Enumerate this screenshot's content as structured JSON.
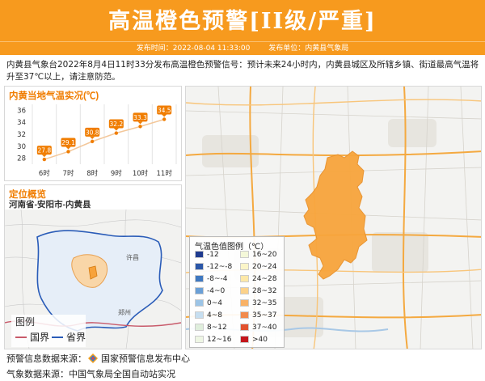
{
  "header": {
    "title": "高温橙色预警[II级/严重]",
    "publish_time_label": "发布时间：2022-08-04 11:33:00",
    "publisher_label": "发布单位：内黄县气象局"
  },
  "description": "内黄县气象台2022年8月4日11时33分发布高温橙色预警信号：预计未来24小时内，内黄县城区及所辖乡镇、街道最高气温将升至37℃以上，请注意防范。",
  "temp_panel": {
    "title": "内黄当地气温实况(℃)"
  },
  "location_panel": {
    "title": "定位概览",
    "path": "河南省-安阳市-内黄县",
    "legend_title": "图例",
    "legend_items": [
      {
        "label": "国界",
        "color": "#c85a6a"
      },
      {
        "label": "省界",
        "color": "#2a5cb8"
      }
    ],
    "place_labels": [
      "许昌",
      "郑州"
    ]
  },
  "map_panel": {
    "legend_title": "气温色值图例（℃）",
    "left_entries": [
      {
        "label": "-12",
        "color": "#1f3b8f"
      },
      {
        "label": "-12~-8",
        "color": "#2b57a8"
      },
      {
        "label": "-8~-4",
        "color": "#3f78c0"
      },
      {
        "label": "-4~0",
        "color": "#6a9fd6"
      },
      {
        "label": "0~4",
        "color": "#9cc4e6"
      },
      {
        "label": "4~8",
        "color": "#c6def0"
      },
      {
        "label": "8~12",
        "color": "#dfeedc"
      },
      {
        "label": "12~16",
        "color": "#eef6e4"
      }
    ],
    "right_entries": [
      {
        "label": "16~20",
        "color": "#f4f8d9"
      },
      {
        "label": "20~24",
        "color": "#fbf5c8"
      },
      {
        "label": "24~28",
        "color": "#fde8a8"
      },
      {
        "label": "28~32",
        "color": "#fcd28a"
      },
      {
        "label": "32~35",
        "color": "#f9b267"
      },
      {
        "label": "35~37",
        "color": "#f28a4c"
      },
      {
        "label": "37~40",
        "color": "#e2522e"
      },
      {
        "label": ">40",
        "color": "#c4161c"
      }
    ]
  },
  "sources": {
    "warning_source": "预警信息数据来源：",
    "warning_source_name": "国家预警信息发布中心",
    "weather_source": "气象数据来源：中国气象局全国自动站实况"
  },
  "chart_data": {
    "type": "line",
    "title": "内黄当地气温实况(℃)",
    "categories": [
      "6时",
      "7时",
      "8时",
      "9时",
      "10时",
      "11时"
    ],
    "values": [
      27.8,
      29.1,
      30.8,
      32.2,
      33.3,
      34.5
    ],
    "yticks": [
      "28",
      "30",
      "32",
      "34",
      "36"
    ],
    "ylim": [
      27,
      37
    ],
    "grid": true,
    "colors": {
      "line": "#f3c79a",
      "point": "#f07d00",
      "label": "#f07d00"
    }
  }
}
